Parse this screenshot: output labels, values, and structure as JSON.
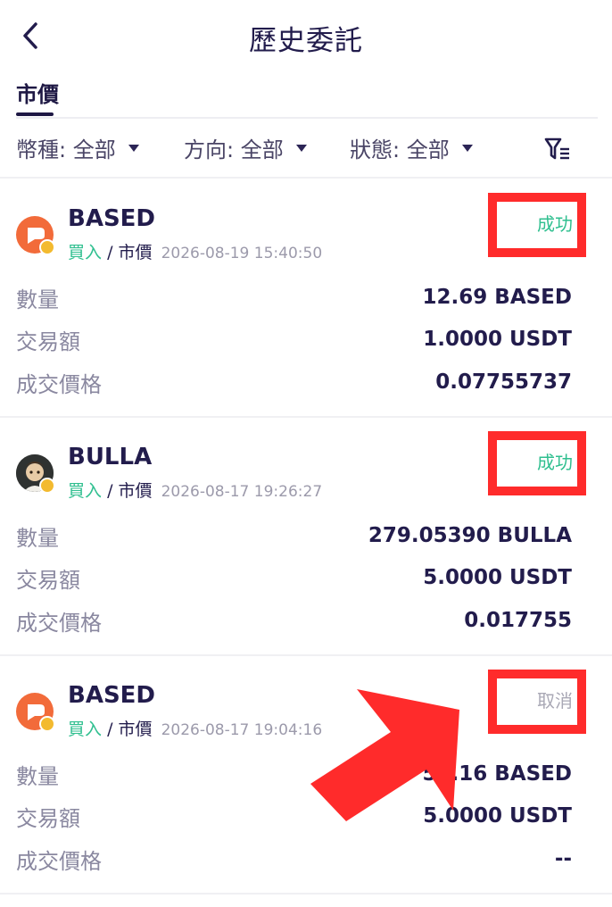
{
  "header": {
    "title": "歷史委託"
  },
  "tabs": [
    {
      "label": "市價"
    }
  ],
  "filters": [
    {
      "label": "幣種: 全部"
    },
    {
      "label": "方向: 全部"
    },
    {
      "label": "狀態: 全部"
    }
  ],
  "orders": [
    {
      "coin": "BASED",
      "side": "買入",
      "sep": "/",
      "order_type": "市價",
      "time": "2026-08-19 15:40:50",
      "status": "成功",
      "rows": [
        {
          "label": "數量",
          "value": "12.69 BASED"
        },
        {
          "label": "交易額",
          "value": "1.0000 USDT"
        },
        {
          "label": "成交價格",
          "value": "0.07755737"
        }
      ]
    },
    {
      "coin": "BULLA",
      "side": "買入",
      "sep": "/",
      "order_type": "市價",
      "time": "2026-08-17 19:26:27",
      "status": "成功",
      "rows": [
        {
          "label": "數量",
          "value": "279.05390 BULLA"
        },
        {
          "label": "交易額",
          "value": "5.0000 USDT"
        },
        {
          "label": "成交價格",
          "value": "0.017755"
        }
      ]
    },
    {
      "coin": "BASED",
      "side": "買入",
      "sep": "/",
      "order_type": "市價",
      "time": "2026-08-17 19:04:16",
      "status": "取消",
      "rows": [
        {
          "label": "數量",
          "value": "52.16 BASED"
        },
        {
          "label": "交易額",
          "value": "5.0000 USDT"
        },
        {
          "label": "成交價格",
          "value": "--"
        }
      ]
    }
  ],
  "colors": {
    "success": "#2fbf8f",
    "cancel": "#a9a8b5",
    "highlight": "#ff2b2b",
    "text_primary": "#221c4c"
  },
  "icons": [
    "back-arrow-icon",
    "caret-down-icon",
    "filter-icon",
    "based-coin-icon",
    "bulla-coin-icon",
    "chain-badge-icon",
    "pointer-arrow-icon"
  ]
}
